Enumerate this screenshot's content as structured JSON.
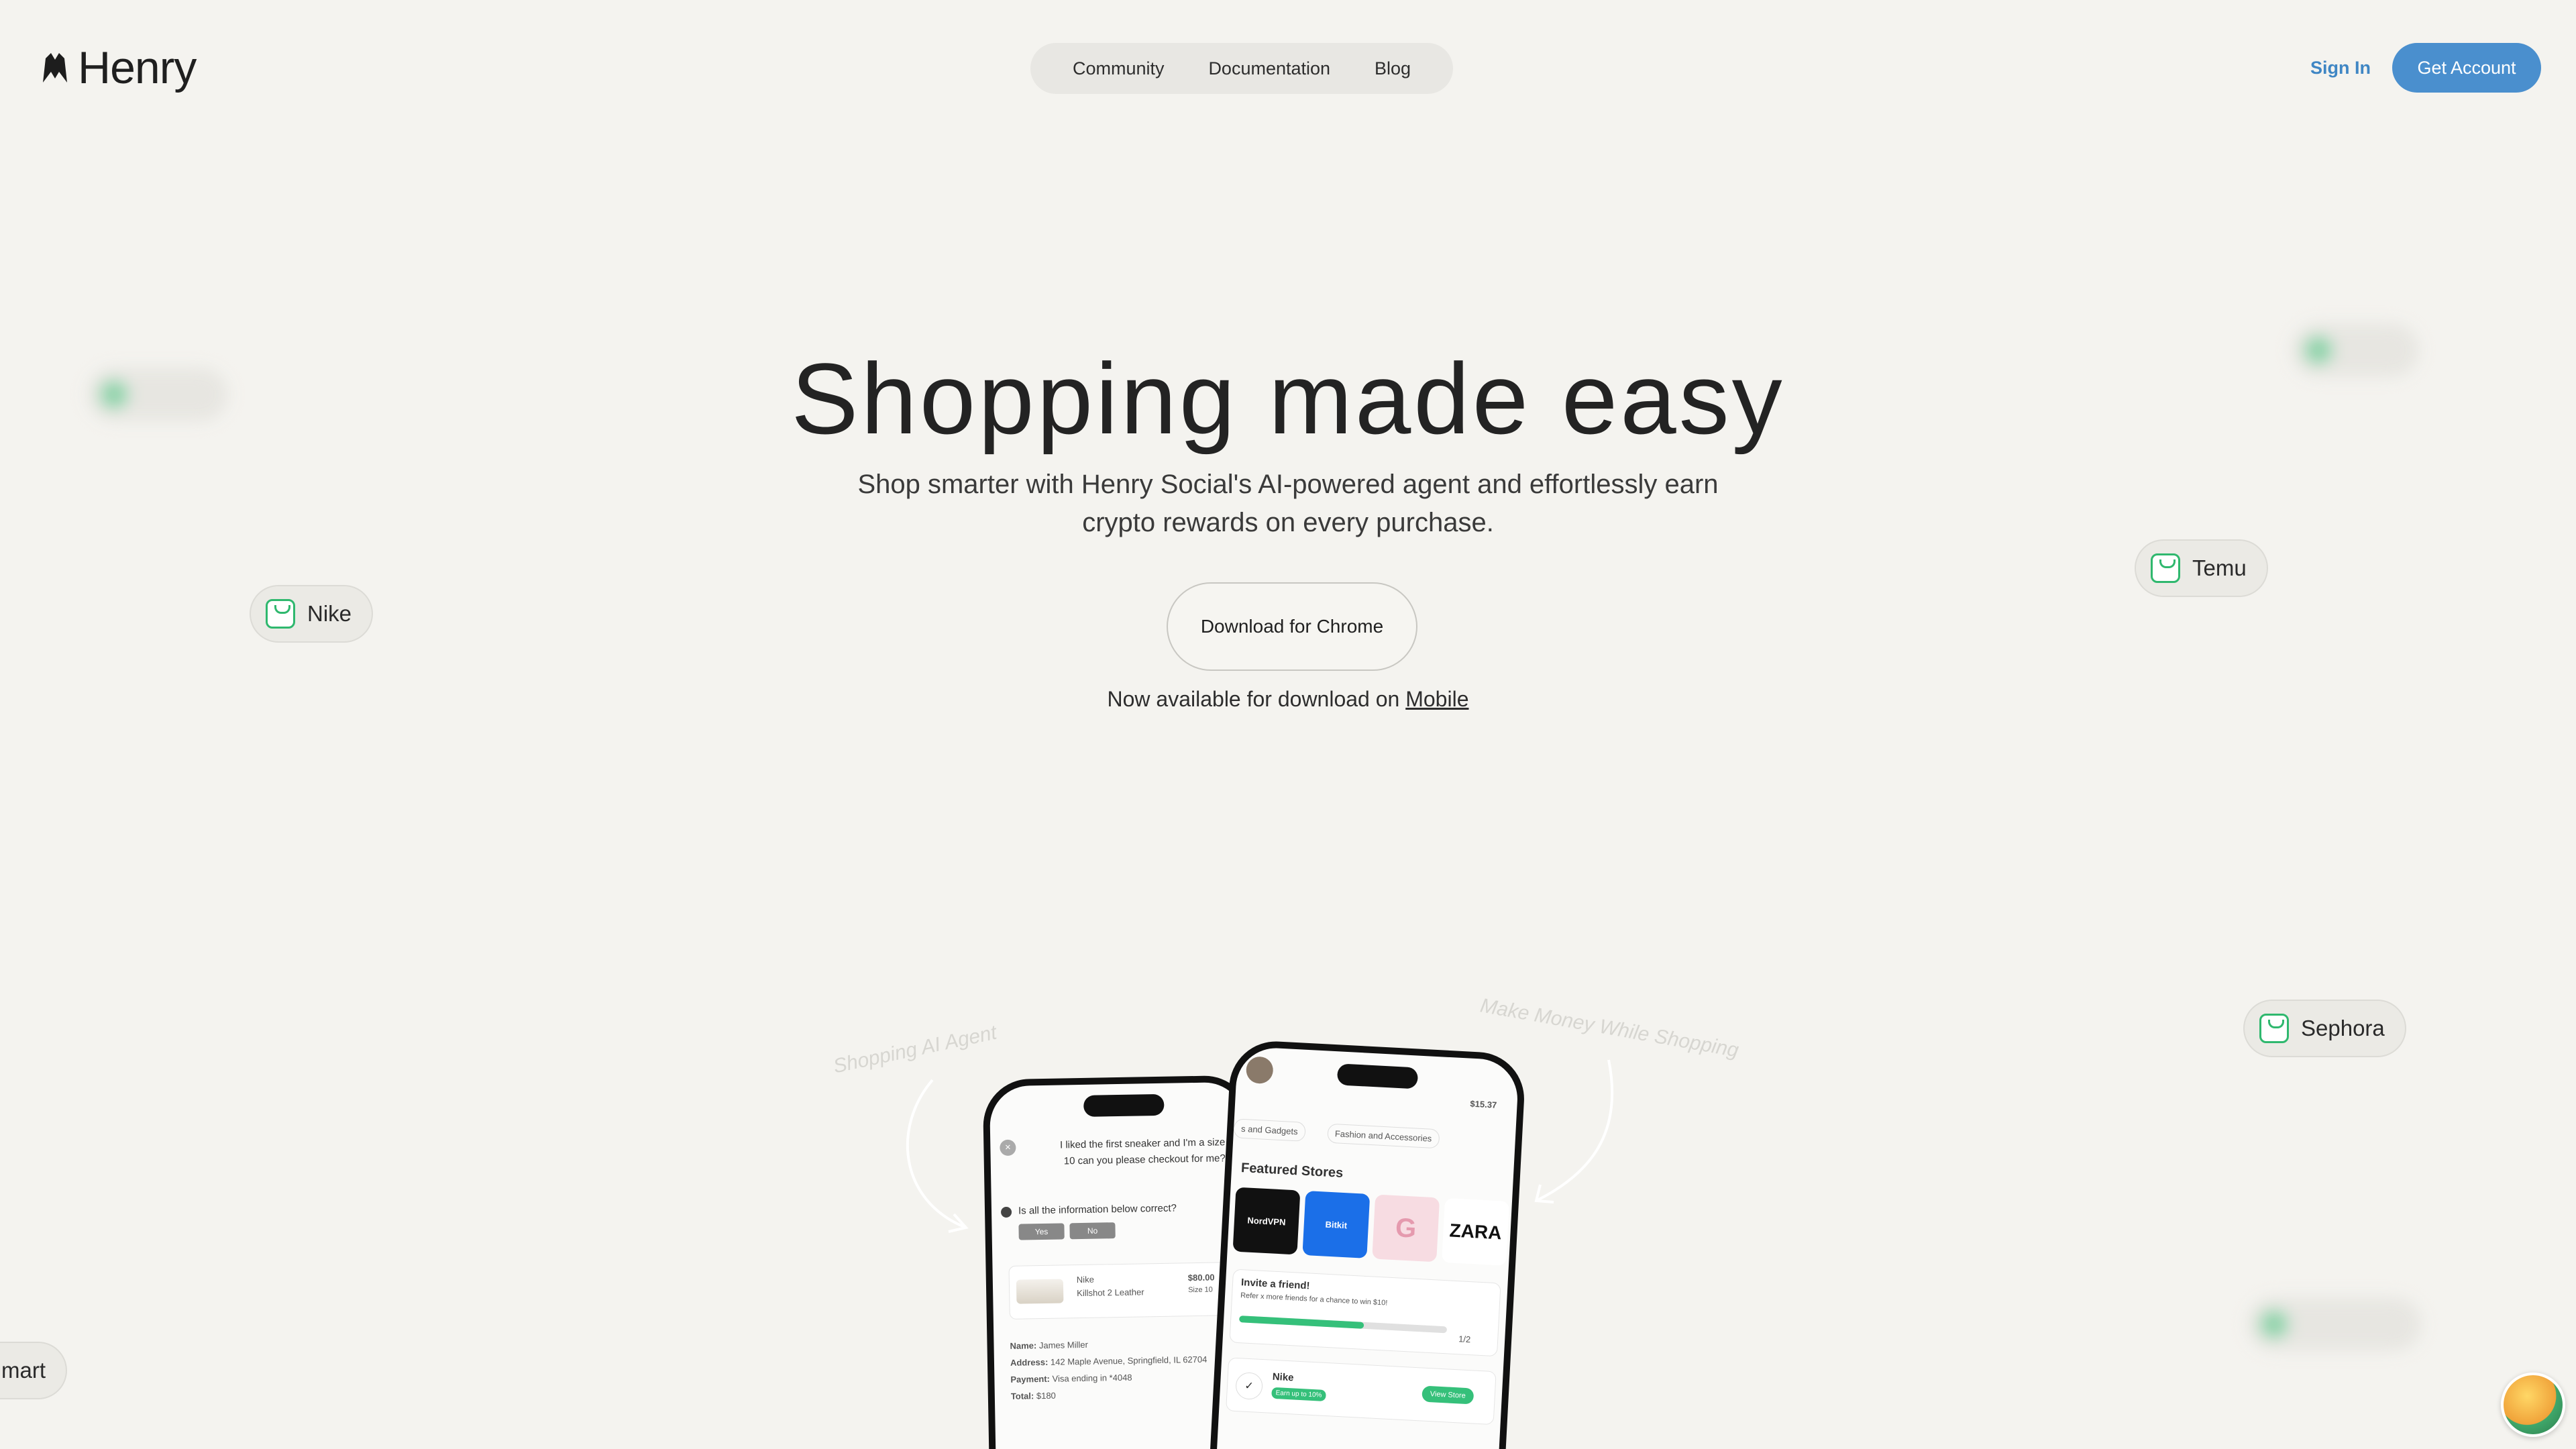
{
  "brand": {
    "name": "Henry"
  },
  "nav": {
    "items": [
      "Community",
      "Documentation",
      "Blog"
    ]
  },
  "auth": {
    "sign_in": "Sign In",
    "get_account": "Get Account"
  },
  "hero": {
    "title": "Shopping made easy",
    "subtitle": "Shop smarter with Henry Social's AI-powered agent and effortlessly earn crypto rewards on every purchase.",
    "download_button": "Download for Chrome",
    "mobile_prefix": "Now available for download on",
    "mobile_link": "Mobile"
  },
  "chips": {
    "nike": "Nike",
    "temu": "Temu",
    "sephora": "Sephora",
    "walmart_partial": "mart"
  },
  "labels": {
    "left_curve": "Shopping AI Agent",
    "right_curve": "Make Money While Shopping"
  },
  "phone_left": {
    "message": "I liked the first sneaker and I'm a size 10 can you please checkout for me?",
    "question": "Is all the information below correct?",
    "yes": "Yes",
    "no": "No",
    "product_brand": "Nike",
    "product_name": "Killshot 2 Leather",
    "product_price": "$80.00",
    "product_size": "Size 10",
    "name_label": "Name:",
    "name_value": "James Miller",
    "address_label": "Address:",
    "address_value": "142 Maple Avenue, Springfield, IL 62704",
    "payment_label": "Payment:",
    "payment_value": "Visa ending in *4048",
    "total_label": "Total:",
    "total_value": "$180"
  },
  "phone_right": {
    "balance": "$15.37",
    "categories": [
      "s and Gadgets",
      "Fashion and Accessories"
    ],
    "featured_title": "Featured Stores",
    "stores": [
      "NordVPN",
      "Bitkit",
      "",
      "ZARA"
    ],
    "invite_title": "Invite a friend!",
    "invite_sub": "Refer x more friends for a chance to win $10!",
    "invite_progress": 0.6,
    "invite_count": "1/2",
    "store_name": "Nike",
    "store_badge": "Earn up to 10%",
    "view_store": "View Store"
  }
}
